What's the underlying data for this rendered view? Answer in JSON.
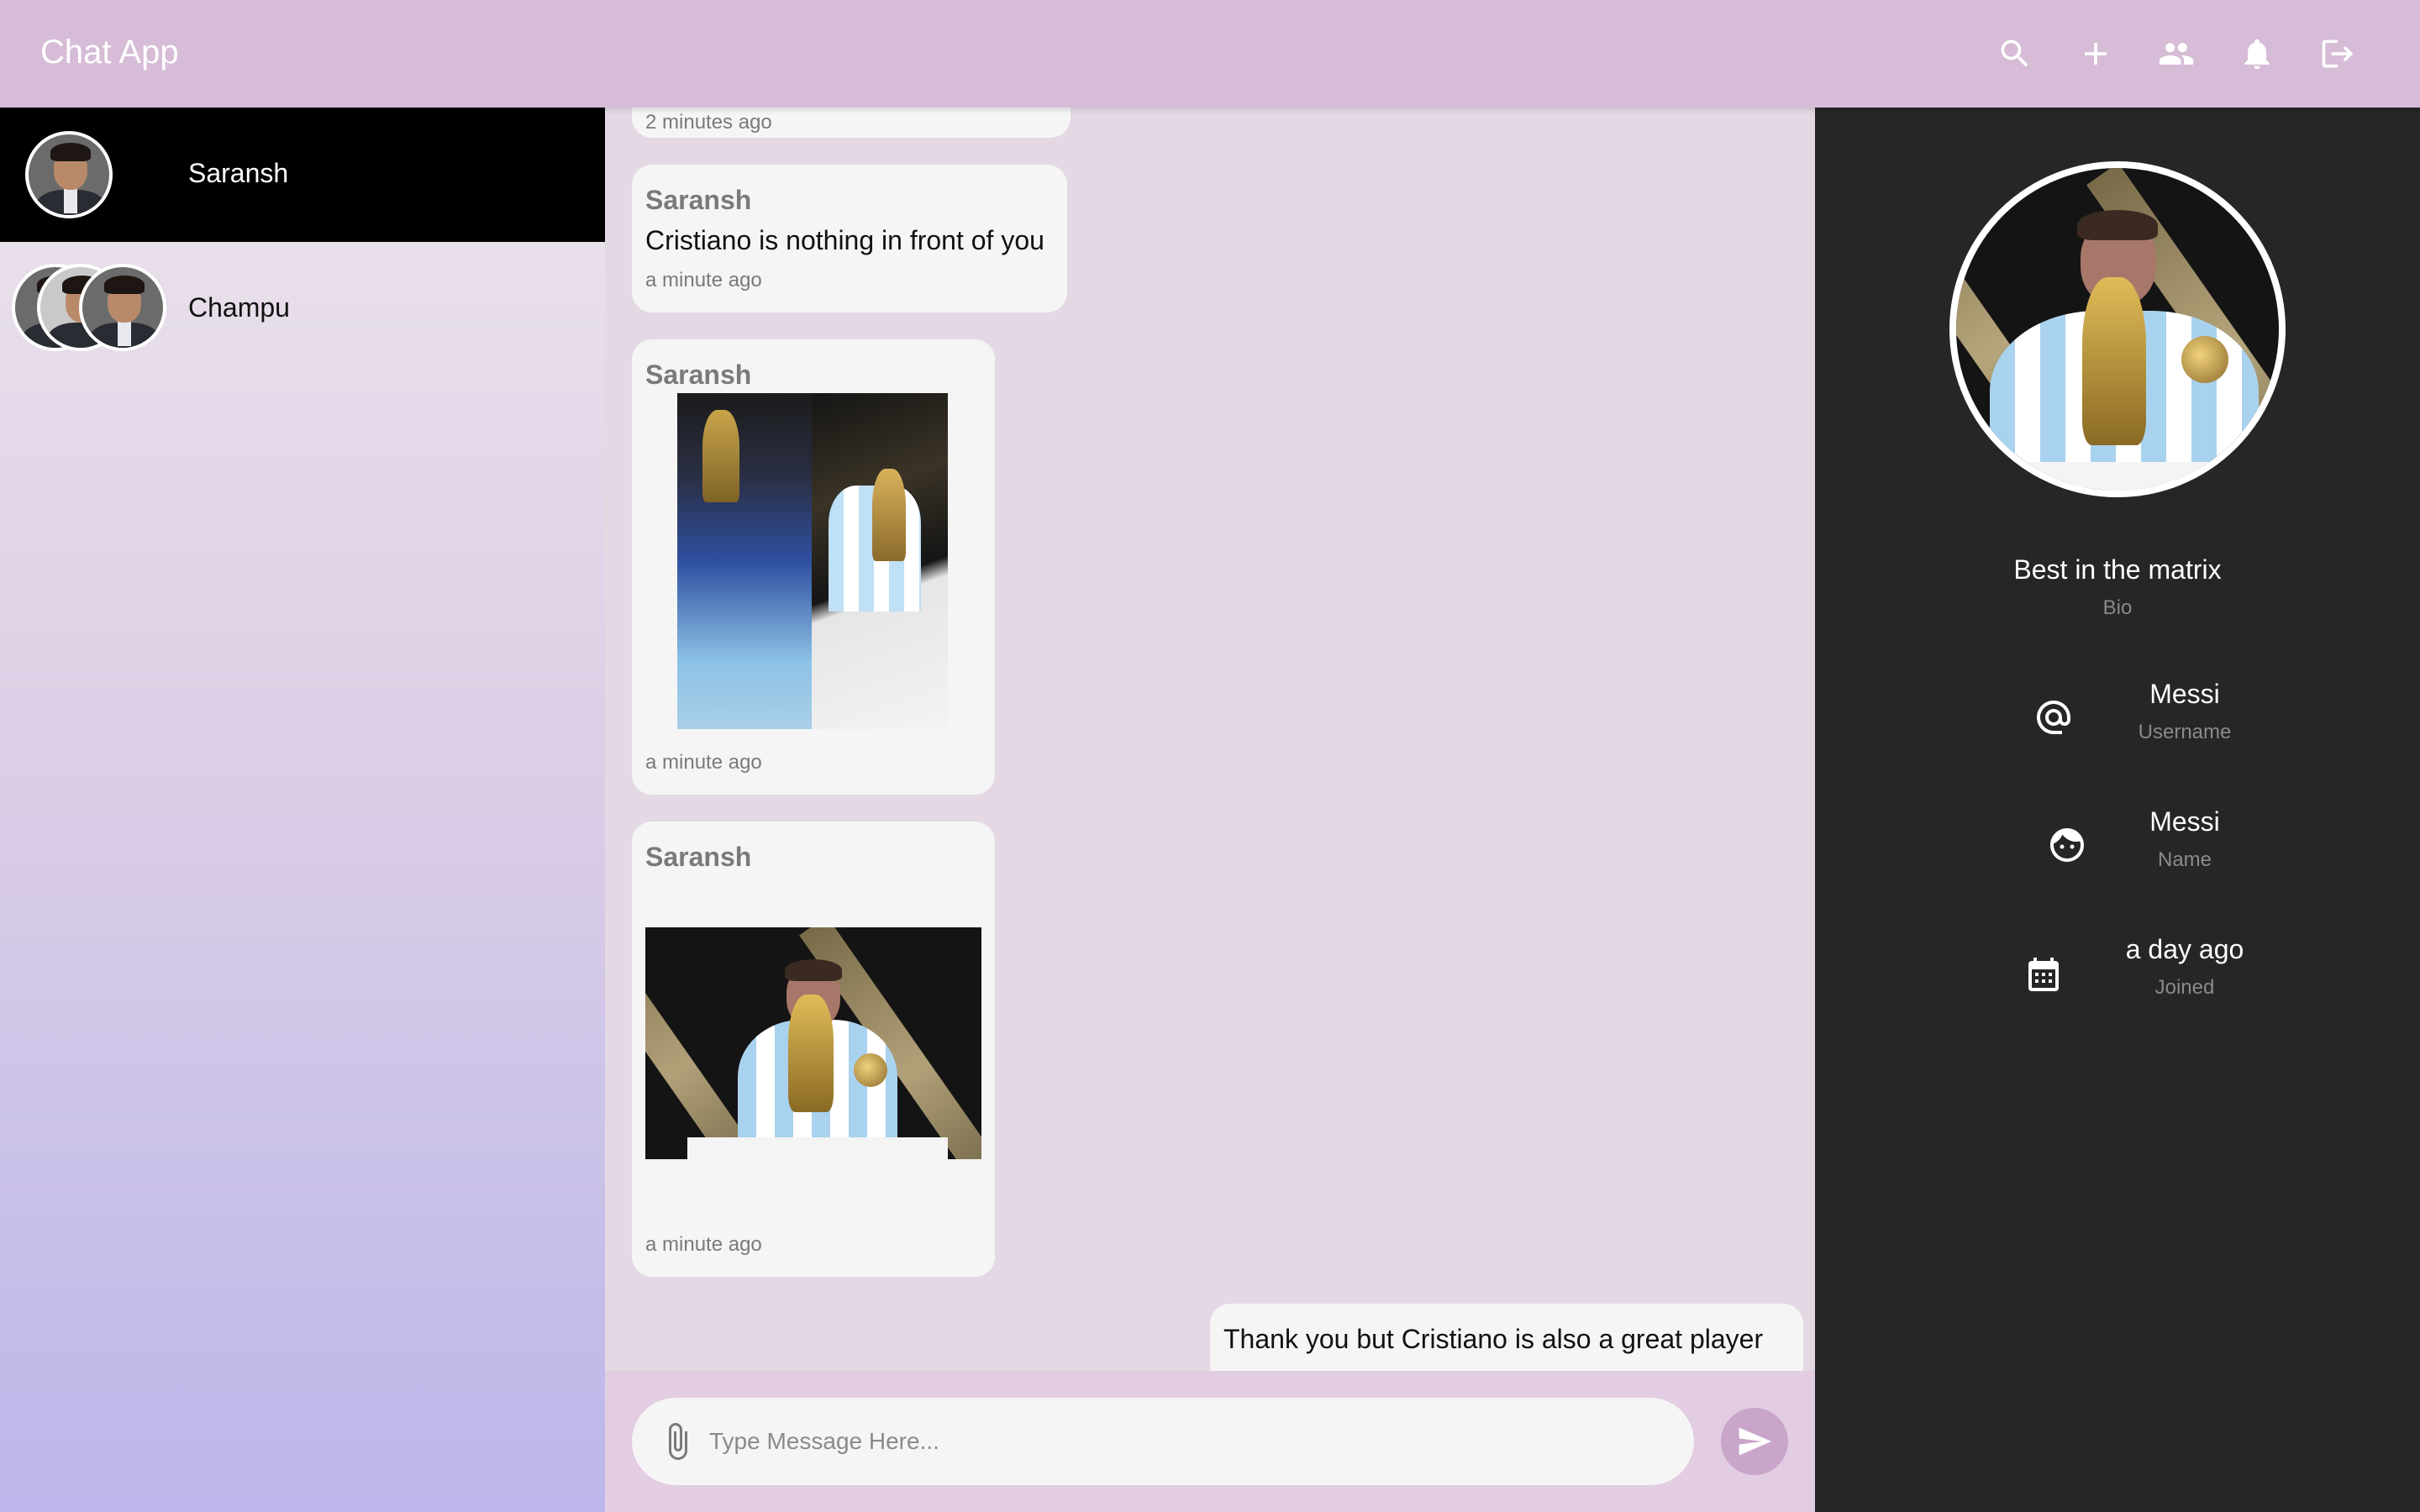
{
  "header": {
    "title": "Chat App",
    "icons": [
      "search-icon",
      "add-icon",
      "group-icon",
      "notifications-icon",
      "logout-icon"
    ]
  },
  "sidebar": {
    "chats": [
      {
        "name": "Saransh",
        "active": true
      },
      {
        "name": "Champu",
        "active": false
      }
    ]
  },
  "messages": [
    {
      "time": "2 minutes ago"
    },
    {
      "sender": "Saransh",
      "text": "Cristiano is nothing in front of you",
      "time": "a minute ago"
    },
    {
      "sender": "Saransh",
      "type": "image-collage",
      "time": "a minute ago"
    },
    {
      "sender": "Saransh",
      "type": "image",
      "time": "a minute ago"
    },
    {
      "text": "Thank you but Cristiano is also a great player",
      "own": true
    }
  ],
  "composer": {
    "placeholder": "Type Message Here...",
    "value": ""
  },
  "profile": {
    "bio": "Best in the matrix",
    "bio_label": "Bio",
    "username": "Messi",
    "username_label": "Username",
    "name": "Messi",
    "name_label": "Name",
    "joined": "a day ago",
    "joined_label": "Joined"
  },
  "colors": {
    "appbar": "#d6bcd6",
    "active_chat": "#000000",
    "profile_panel": "#262626",
    "send_button": "#c9a6c9"
  }
}
